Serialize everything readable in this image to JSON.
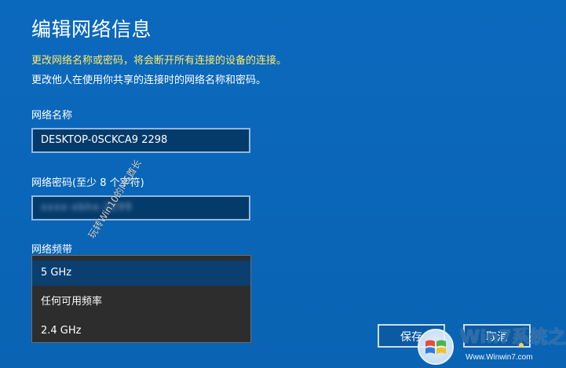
{
  "dialog": {
    "title": "编辑网络信息",
    "warning": "更改网络名称或密码，将会断开所有连接的设备的连接。",
    "info": "更改他人在使用你共享的连接时的网络名称和密码。"
  },
  "network_name": {
    "label": "网络名称",
    "value": "DESKTOP-0SCKCA9 2298"
  },
  "network_password": {
    "label": "网络密码(至少 8 个字符)",
    "value": "xxxx-xbhx-2299"
  },
  "network_band": {
    "label": "网络频带",
    "options": [
      {
        "label": "5 GHz",
        "selected": true
      },
      {
        "label": "任何可用频率",
        "selected": false
      },
      {
        "label": "2.4 GHz",
        "selected": false
      }
    ]
  },
  "buttons": {
    "save": "保存",
    "cancel": "取消"
  },
  "watermark": {
    "text": "玩转Win10的MS酋长",
    "brand": "Win7系统之家",
    "url": "Www.Winwin7.com"
  },
  "colors": {
    "background": "#0b64b5",
    "warning": "#ffe96b",
    "field_bg": "#053b6b",
    "dropdown_bg": "#2d2d2d"
  },
  "icons": {
    "logo": "windows-logo-icon"
  }
}
